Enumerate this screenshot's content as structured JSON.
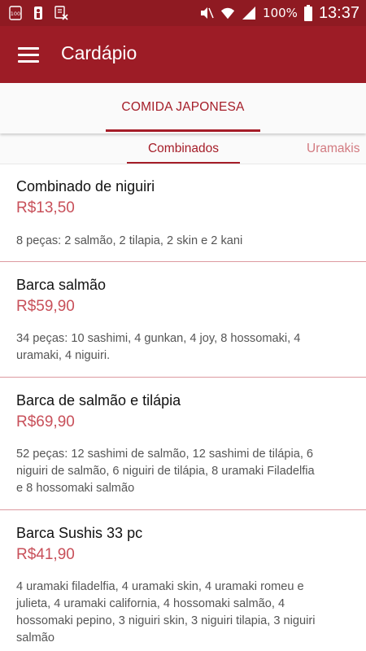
{
  "status_bar": {
    "left_icons": [
      "notification-100-icon",
      "nba-app-icon",
      "download-notification-icon"
    ],
    "battery_percent": "100%",
    "time": "13:37"
  },
  "app_bar": {
    "title": "Cardápio"
  },
  "category_tabs": [
    {
      "label": "COMIDA JAPONESA",
      "selected": true
    }
  ],
  "sub_tabs": [
    {
      "label": "Combinados",
      "selected": true
    },
    {
      "label": "Uramakis",
      "selected": false
    }
  ],
  "menu_items": [
    {
      "name": "Combinado de niguiri",
      "price": "R$13,50",
      "description_lines": [
        "8 peças: 2 salmão, 2 tilapia, 2 skin e 2 kani"
      ]
    },
    {
      "name": "Barca salmão",
      "price": "R$59,90",
      "description_lines": [
        "34 peças: 10 sashimi, 4 gunkan, 4 joy, 8 hossomaki, 4",
        "uramaki, 4 niguiri."
      ]
    },
    {
      "name": "Barca de salmão e tilápia",
      "price": "R$69,90",
      "description_lines": [
        "52 peças: 12 sashimi de salmão, 12 sashimi de tilápia, 6",
        "niguiri de salmão, 6 niguiri de tilápia, 8 uramaki Filadelfia",
        "e 8 hossomaki salmão"
      ]
    },
    {
      "name": "Barca Sushis 33 pc",
      "price": "R$41,90",
      "description_lines": [
        "4 uramaki filadelfia, 4 uramaki skin, 4 uramaki romeu e",
        "julieta, 4 uramaki california, 4 hossomaki salmão, 4",
        "hossomaki pepino, 3 niguiri skin, 3 niguiri tilapia, 3 niguiri",
        "salmão"
      ]
    }
  ],
  "colors": {
    "status_bar": "#8f1a22",
    "app_bar": "#9d1c26",
    "accent": "#a51d28",
    "price": "#c8505a",
    "divider": "#dd9aa0"
  }
}
